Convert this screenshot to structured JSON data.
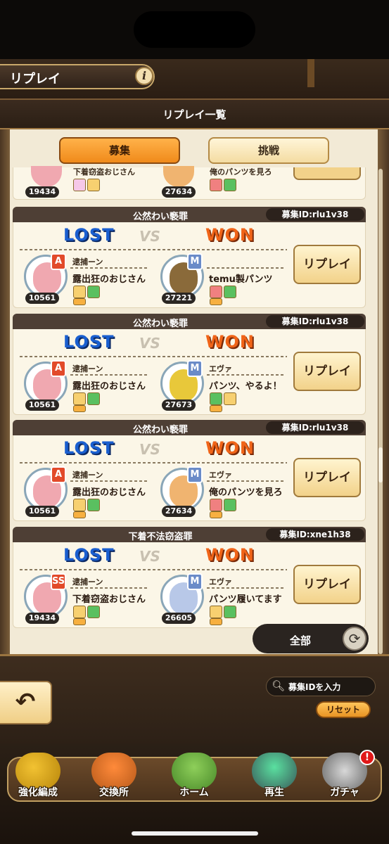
{
  "header": {
    "title": "リプレイ",
    "info_icon": "i"
  },
  "list_title": "リプレイ一覧",
  "tabs": [
    {
      "label": "募集"
    },
    {
      "label": "挑戦"
    }
  ],
  "partial_card": {
    "left": {
      "power": "19434",
      "name": "下着窃盗おじさん"
    },
    "right": {
      "power": "27634",
      "name": "俺のパンツを見ろ"
    }
  },
  "vs_text": "VS",
  "result_lost": "LOST",
  "result_won": "WON",
  "replay_label": "リプレイ",
  "cards": [
    {
      "crime": "公然わい褻罪",
      "recruit_id": "募集ID:rlu1v38",
      "left": {
        "player": "逮捕ーン",
        "char": "露出狂のおじさん",
        "power": "10561",
        "grade": "A"
      },
      "right": {
        "player": "",
        "char": "temu製パンツ",
        "power": "27221",
        "grade": "M"
      }
    },
    {
      "crime": "公然わい褻罪",
      "recruit_id": "募集ID:rlu1v38",
      "left": {
        "player": "逮捕ーン",
        "char": "露出狂のおじさん",
        "power": "10561",
        "grade": "A"
      },
      "right": {
        "player": "エヴァ",
        "char": "パンツ、やるよ！",
        "power": "27673",
        "grade": "M"
      }
    },
    {
      "crime": "公然わい褻罪",
      "recruit_id": "募集ID:rlu1v38",
      "left": {
        "player": "逮捕ーン",
        "char": "露出狂のおじさん",
        "power": "10561",
        "grade": "A"
      },
      "right": {
        "player": "エヴァ",
        "char": "俺のパンツを見ろ",
        "power": "27634",
        "grade": "M"
      }
    },
    {
      "crime": "下着不法窃盗罪",
      "recruit_id": "募集ID:xne1h38",
      "left": {
        "player": "逮捕ーン",
        "char": "下着窃盗おじさん",
        "power": "19434",
        "grade": "SS"
      },
      "right": {
        "player": "エヴァ",
        "char": "パンツ履いてます",
        "power": "26605",
        "grade": "M"
      }
    }
  ],
  "filter": {
    "label": "全部"
  },
  "search": {
    "placeholder": "募集IDを入力"
  },
  "reset_label": "リセット",
  "nav": [
    {
      "label": "強化編成"
    },
    {
      "label": "交換所"
    },
    {
      "label": "ホーム"
    },
    {
      "label": "再生"
    },
    {
      "label": "ガチャ"
    }
  ],
  "badge": "!",
  "colors": {
    "lost": "#1a5fd0",
    "won": "#f06418",
    "tab_active": "#f5a030",
    "panel": "#f2ead6"
  }
}
